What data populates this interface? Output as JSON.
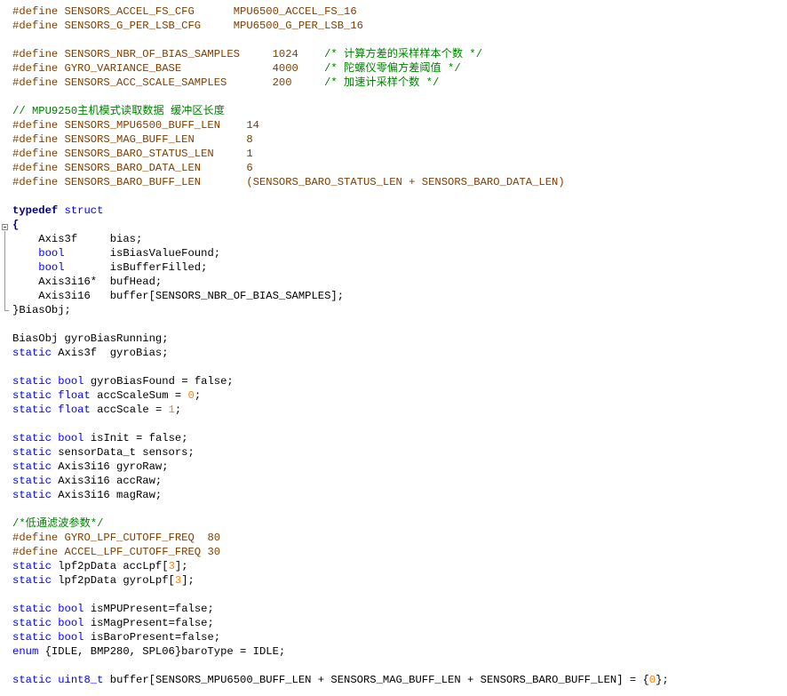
{
  "code": {
    "l01": {
      "kw": "#define SENSORS_ACCEL_FS_CFG",
      "val": "MPU6500_ACCEL_FS_16"
    },
    "l02": {
      "kw": "#define SENSORS_G_PER_LSB_CFG",
      "val": "MPU6500_G_PER_LSB_16"
    },
    "l03": {
      "kw": "#define SENSORS_NBR_OF_BIAS_SAMPLES",
      "val": "1024",
      "cm": "/* 计算方差的采样样本个数 */"
    },
    "l04": {
      "kw": "#define GYRO_VARIANCE_BASE",
      "val": "4000",
      "cm": "/* 陀螺仪零偏方差阈值 */"
    },
    "l05": {
      "kw": "#define SENSORS_ACC_SCALE_SAMPLES",
      "val": "200",
      "cm": "/* 加速计采样个数 */"
    },
    "l06": {
      "cm": "// MPU9250主机模式读取数据 缓冲区长度"
    },
    "l07": {
      "kw": "#define SENSORS_MPU6500_BUFF_LEN",
      "val": "14"
    },
    "l08": {
      "kw": "#define SENSORS_MAG_BUFF_LEN",
      "val": "8"
    },
    "l09": {
      "kw": "#define SENSORS_BARO_STATUS_LEN",
      "val": "1"
    },
    "l10": {
      "kw": "#define SENSORS_BARO_DATA_LEN",
      "val": "6"
    },
    "l11": {
      "kw": "#define SENSORS_BARO_BUFF_LEN",
      "val": "(SENSORS_BARO_STATUS_LEN + SENSORS_BARO_DATA_LEN)"
    },
    "l12": {
      "kw": "typedef",
      "kw2": "struct"
    },
    "l13": {
      "txt": "{"
    },
    "l14": {
      "type": "Axis3f",
      "name": "bias;"
    },
    "l15": {
      "type": "bool",
      "name": "isBiasValueFound;"
    },
    "l16": {
      "type": "bool",
      "name": "isBufferFilled;"
    },
    "l17": {
      "type": "Axis3i16*",
      "name": "bufHead;"
    },
    "l18": {
      "type": "Axis3i16",
      "name": "buffer[SENSORS_NBR_OF_BIAS_SAMPLES];"
    },
    "l19": {
      "txt": "}BiasObj;"
    },
    "l20": {
      "txt": "BiasObj gyroBiasRunning;"
    },
    "l21": {
      "kw": "static",
      "txt": "Axis3f  gyroBias;"
    },
    "l22": {
      "kw": "static",
      "kw2": "bool",
      "txt": "gyroBiasFound = false;"
    },
    "l23": {
      "kw": "static",
      "kw2": "float",
      "txt": "accScaleSum = ",
      "num": "0",
      "end": ";"
    },
    "l24": {
      "kw": "static",
      "kw2": "float",
      "txt": "accScale = ",
      "num": "1",
      "end": ";"
    },
    "l25": {
      "kw": "static",
      "kw2": "bool",
      "txt": "isInit = false;"
    },
    "l26": {
      "kw": "static",
      "txt": "sensorData_t sensors;"
    },
    "l27": {
      "kw": "static",
      "txt": "Axis3i16 gyroRaw;"
    },
    "l28": {
      "kw": "static",
      "txt": "Axis3i16 accRaw;"
    },
    "l29": {
      "kw": "static",
      "txt": "Axis3i16 magRaw;"
    },
    "l30": {
      "cm": "/*低通滤波参数*/"
    },
    "l31": {
      "kw": "#define GYRO_LPF_CUTOFF_FREQ",
      "val": "80"
    },
    "l32": {
      "kw": "#define ACCEL_LPF_CUTOFF_FREQ",
      "val": "30"
    },
    "l33": {
      "kw": "static",
      "txt": "lpf2pData accLpf[",
      "num": "3",
      "end": "];"
    },
    "l34": {
      "kw": "static",
      "txt": "lpf2pData gyroLpf[",
      "num": "3",
      "end": "];"
    },
    "l35": {
      "kw": "static",
      "kw2": "bool",
      "txt": "isMPUPresent=false;"
    },
    "l36": {
      "kw": "static",
      "kw2": "bool",
      "txt": "isMagPresent=false;"
    },
    "l37": {
      "kw": "static",
      "kw2": "bool",
      "txt": "isBaroPresent=false;"
    },
    "l38": {
      "kw": "enum",
      "txt": "{IDLE, BMP280, SPL06}baroType = IDLE;"
    },
    "l39": {
      "kw": "static",
      "kw2": "uint8_t",
      "txt": "buffer[SENSORS_MPU6500_BUFF_LEN + SENSORS_MAG_BUFF_LEN + SENSORS_BARO_BUFF_LEN] = {",
      "num": "0",
      "end": "};"
    }
  }
}
